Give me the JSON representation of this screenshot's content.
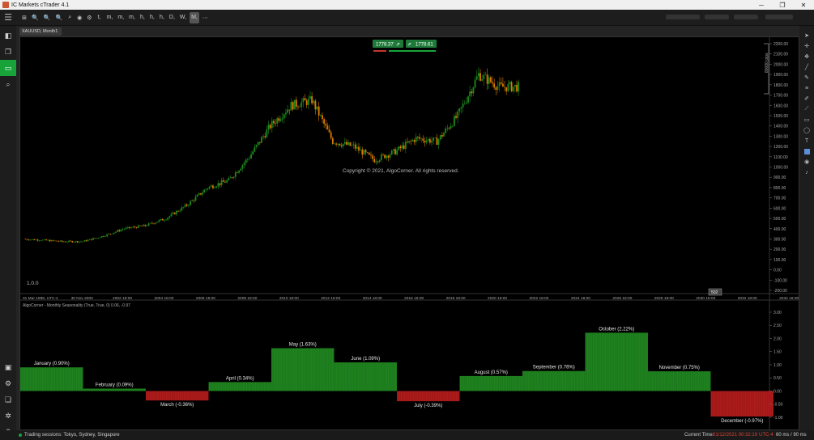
{
  "window": {
    "title": "IC Markets cTrader 4.1"
  },
  "toolbar": {
    "buttons": [
      "⊞",
      "🔍",
      "🔍",
      "🔍",
      "⌕",
      "◉",
      "⚙",
      "t,",
      "m,",
      "m,",
      "m,",
      "h,",
      "h,",
      "h,",
      "D,",
      "W,",
      "M,",
      "⋯"
    ],
    "active_label": "M,"
  },
  "chart": {
    "tab_label": "XAUUSD, Month1",
    "bid_price": "1778.37",
    "ask_price": "1778.61",
    "copyright": "Copyright © 2021, AlgoCorner. All rights reserved.",
    "version": "1.0.0",
    "pips_label": "80000 pips",
    "current_price_tag": "502",
    "indicator_label": "AlgoCorner - Monthly Seasonality (True, True, 0) 0.06, -0.97",
    "time_labels": [
      "31 Mar 1998, UTC-4",
      "30 Nov 2000",
      "2002 18:00",
      "2004 18:00",
      "2006 18:00",
      "2008 18:00",
      "2010 18:00",
      "2012 18:00",
      "2014 18:00",
      "2016 18:00",
      "2018 18:00",
      "2020 18:00",
      "2022 18:00",
      "2024 18:00",
      "2026 18:00",
      "2028 18:00",
      "2030 18:00",
      "2032 18:00",
      "2034 18:00"
    ],
    "price_axis": [
      "2200.00",
      "2100.00",
      "2000.00",
      "1900.00",
      "1800.00",
      "1700.00",
      "1600.00",
      "1500.00",
      "1400.00",
      "1300.00",
      "1200.00",
      "1100.00",
      "1000.00",
      "900.00",
      "800.00",
      "700.00",
      "600.00",
      "500.00",
      "400.00",
      "300.00",
      "200.00",
      "100.00",
      "0.00",
      "-100.00",
      "-200.00"
    ],
    "indicator_axis": [
      "3.00",
      "2.50",
      "2.00",
      "1.50",
      "1.00",
      "0.50",
      "0.00",
      "-0.50",
      "-1.00"
    ]
  },
  "chart_data": [
    {
      "type": "line",
      "title": "XAUUSD, Month1",
      "x": [
        1998,
        1999,
        2000,
        2001,
        2002,
        2003,
        2004,
        2005,
        2006,
        2007,
        2008,
        2009,
        2010,
        2011,
        2012,
        2013,
        2014,
        2015,
        2016,
        2017,
        2018,
        2019,
        2020,
        2021
      ],
      "series": [
        {
          "name": "XAUUSD",
          "values": [
            300,
            290,
            275,
            275,
            330,
            400,
            430,
            500,
            630,
            800,
            870,
            1100,
            1400,
            1600,
            1650,
            1250,
            1200,
            1070,
            1150,
            1280,
            1250,
            1500,
            1900,
            1780
          ]
        }
      ],
      "ylim": [
        -200,
        2200
      ]
    },
    {
      "type": "bar",
      "title": "AlgoCorner - Monthly Seasonality",
      "categories": [
        "January",
        "February",
        "March",
        "April",
        "May",
        "June",
        "July",
        "August",
        "September",
        "October",
        "November",
        "December"
      ],
      "values": [
        0.9,
        0.09,
        -0.36,
        0.34,
        1.63,
        1.09,
        -0.39,
        0.57,
        0.76,
        2.22,
        0.75,
        -0.97
      ],
      "labels": [
        "January (0.90%)",
        "February (0.09%)",
        "March (-0.36%)",
        "April (0.34%)",
        "May (1.63%)",
        "June (1.09%)",
        "July (-0.39%)",
        "August (0.57%)",
        "September (0.76%)",
        "October (2.22%)",
        "November (0.75%)",
        "December (-0.97%)"
      ],
      "ylim": [
        -1.25,
        3.0
      ],
      "colors": {
        "positive": "#1c7a1c",
        "negative": "#a31818"
      }
    }
  ],
  "statusbar": {
    "sessions": "Trading sessions: Tokyo, Sydney, Singapore",
    "current_time_label": "Current Time:",
    "current_time": "01/12/2021 00:32:19",
    "timezone": "UTC-4",
    "latency": "60 ms / 90 ms"
  },
  "colors": {
    "bull": "#1c8a1c",
    "bear": "#d97a00",
    "accent": "#18a33a",
    "time_red": "#e04030"
  }
}
